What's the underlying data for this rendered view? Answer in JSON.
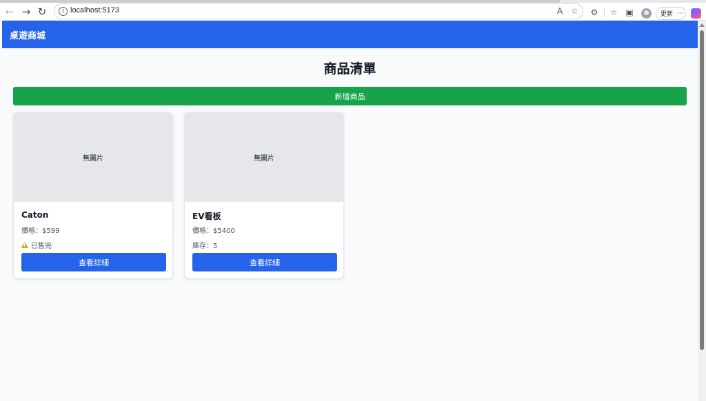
{
  "browser": {
    "url": "localhost:5173",
    "update_label": "更新"
  },
  "header": {
    "title": "桌遊商城"
  },
  "main": {
    "page_title": "商品清單",
    "add_button_label": "新增商品",
    "products": [
      {
        "image_placeholder": "無圖片",
        "name": "Caton",
        "price": "價格：$599",
        "stock": "已售完",
        "sold_out": true,
        "button_label": "查看詳細"
      },
      {
        "image_placeholder": "無圖片",
        "name": "EV看板",
        "price": "價格：$5400",
        "stock": "庫存：5",
        "sold_out": false,
        "button_label": "查看詳細"
      }
    ]
  },
  "colors": {
    "primary": "#2563eb",
    "success": "#16a34a",
    "warning": "#f59e0b"
  }
}
